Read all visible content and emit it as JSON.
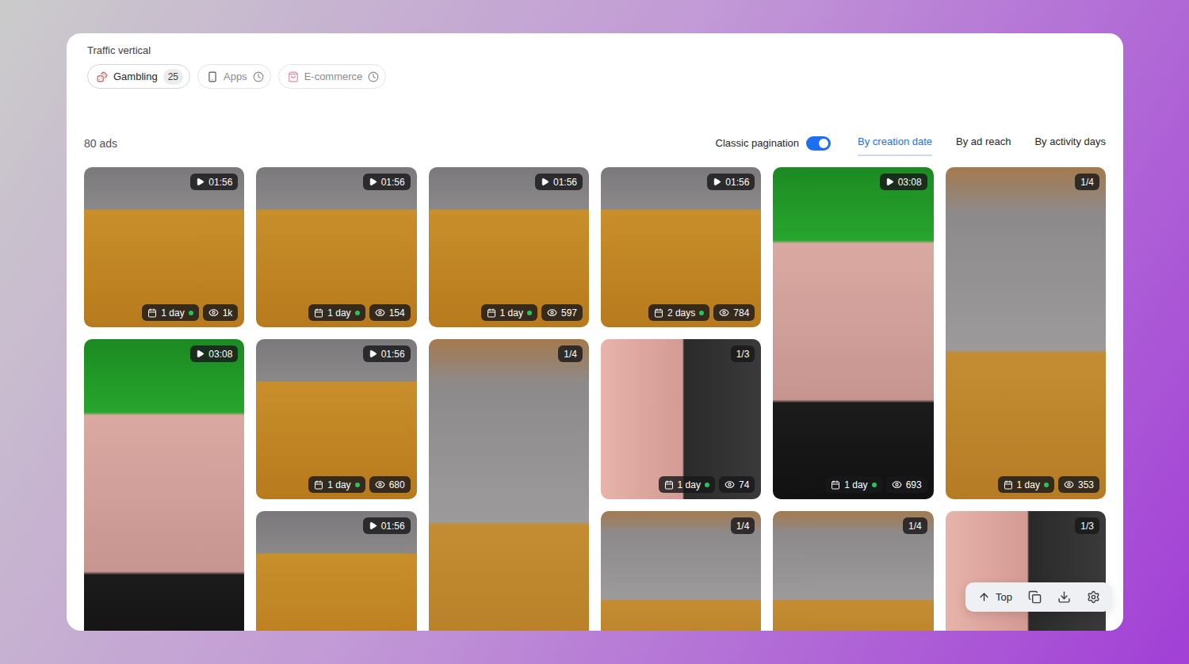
{
  "filters": {
    "title": "Traffic vertical",
    "chips": [
      {
        "label": "Gambling",
        "icon": "gambling",
        "count": "25",
        "disabled": false
      },
      {
        "label": "Apps",
        "icon": "apps",
        "disabled": true
      },
      {
        "label": "E-commerce",
        "icon": "ecommerce",
        "disabled": true
      }
    ]
  },
  "results": {
    "count": "80 ads"
  },
  "pagination": {
    "label": "Classic pagination",
    "on": true
  },
  "sort_tabs": [
    {
      "label": "By creation date",
      "selected": true
    },
    {
      "label": "By ad reach",
      "selected": false
    },
    {
      "label": "By activity days",
      "selected": false
    }
  ],
  "ad_columns": [
    [
      {
        "kind": "garlic-video",
        "portrait": false,
        "video": true,
        "badge": "01:56",
        "days": "1 day",
        "active": true,
        "views": "1k"
      },
      {
        "kind": "doctor-video",
        "portrait": true,
        "video": true,
        "badge": "03:08"
      }
    ],
    [
      {
        "kind": "garlic-video",
        "portrait": false,
        "video": true,
        "badge": "01:56",
        "days": "1 day",
        "active": true,
        "views": "154"
      },
      {
        "kind": "garlic-video",
        "portrait": false,
        "video": true,
        "badge": "01:56",
        "days": "1 day",
        "active": true,
        "views": "680"
      },
      {
        "kind": "garlic-video",
        "portrait": false,
        "video": true,
        "badge": "01:56"
      }
    ],
    [
      {
        "kind": "garlic-video",
        "portrait": false,
        "video": true,
        "badge": "01:56",
        "days": "1 day",
        "active": true,
        "views": "597"
      },
      {
        "kind": "garlic-photo",
        "portrait": true,
        "video": false,
        "badge": "1/4"
      }
    ],
    [
      {
        "kind": "garlic-video",
        "portrait": false,
        "video": true,
        "badge": "01:56",
        "days": "2 days",
        "active": true,
        "views": "784"
      },
      {
        "kind": "doctor-photo",
        "portrait": false,
        "video": false,
        "badge": "1/3",
        "days": "1 day",
        "active": true,
        "views": "74"
      },
      {
        "kind": "garlic-photo",
        "portrait": false,
        "video": false,
        "badge": "1/4"
      }
    ],
    [
      {
        "kind": "doctor-video",
        "portrait": true,
        "video": true,
        "badge": "03:08",
        "days": "1 day",
        "active": true,
        "views": "693"
      },
      {
        "kind": "garlic-photo",
        "portrait": false,
        "video": false,
        "badge": "1/4"
      }
    ],
    [
      {
        "kind": "garlic-photo",
        "portrait": true,
        "video": false,
        "badge": "1/4",
        "days": "1 day",
        "active": true,
        "views": "353"
      },
      {
        "kind": "doctor-photo",
        "portrait": false,
        "video": false,
        "badge": "1/3"
      }
    ]
  ],
  "toolbar": {
    "top": "Top"
  }
}
